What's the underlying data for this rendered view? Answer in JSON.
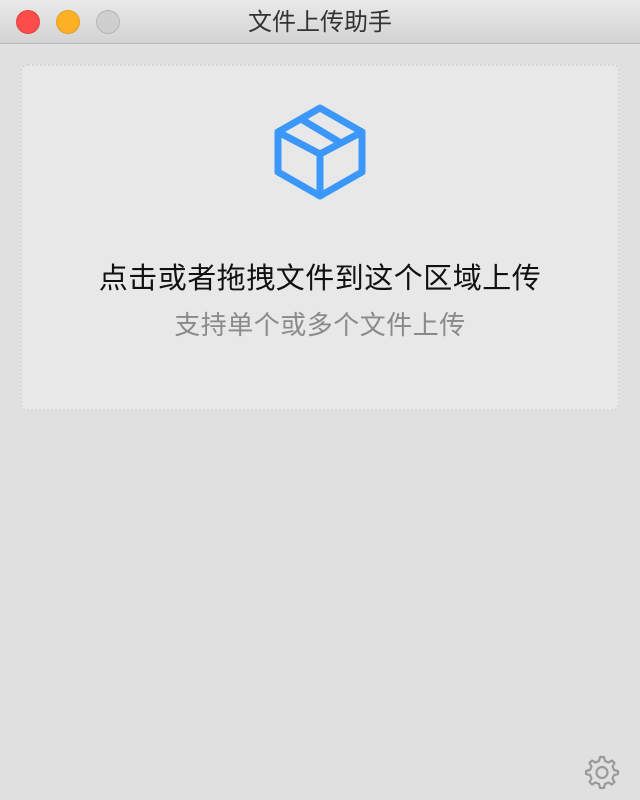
{
  "window": {
    "title": "文件上传助手"
  },
  "dropzone": {
    "icon": "box-icon",
    "primary_text": "点击或者拖拽文件到这个区域上传",
    "secondary_text": "支持单个或多个文件上传"
  },
  "footer": {
    "settings_icon": "gear-icon"
  },
  "colors": {
    "accent": "#3c97fb",
    "close": "#fd4c4a",
    "minimize": "#feb024",
    "zoom": "#cfcfcf",
    "primary_text": "#111111",
    "secondary_text": "#8a8a8a",
    "background": "#e0e0e0"
  }
}
